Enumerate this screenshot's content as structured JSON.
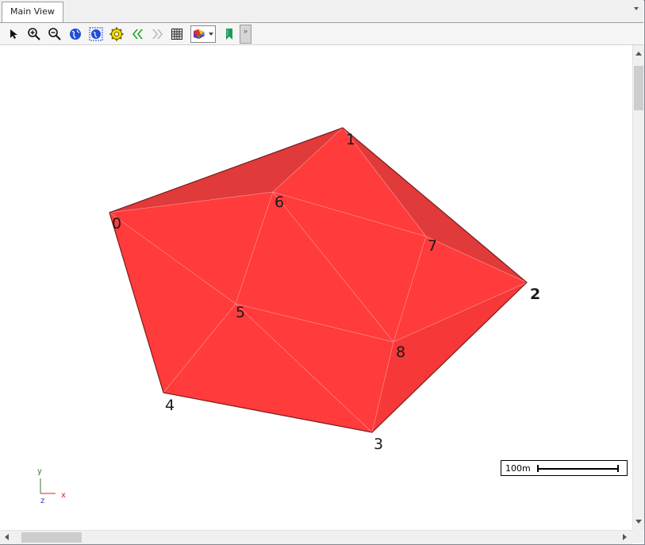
{
  "window": {
    "tab_label": "Main View"
  },
  "toolbar": {
    "tools": [
      {
        "name": "select-pointer-icon"
      },
      {
        "name": "zoom-in-icon"
      },
      {
        "name": "zoom-out-icon"
      },
      {
        "name": "globe-icon"
      },
      {
        "name": "globe-grid-icon"
      },
      {
        "name": "settings-gear-icon"
      },
      {
        "name": "previous-icon"
      },
      {
        "name": "next-icon"
      },
      {
        "name": "grid-icon"
      },
      {
        "name": "color-style-dropdown"
      },
      {
        "name": "bookmark-icon"
      }
    ],
    "overflow_label": "»"
  },
  "mesh": {
    "fill_color": "#ff3b3b",
    "dark_fill_color": "#e03a3a",
    "nodes": [
      "0",
      "1",
      "2",
      "3",
      "4",
      "5",
      "6",
      "7",
      "8"
    ]
  },
  "axes": {
    "y_label": "y",
    "x_label": "x",
    "z_label": "z"
  },
  "scale": {
    "label": "100m"
  }
}
